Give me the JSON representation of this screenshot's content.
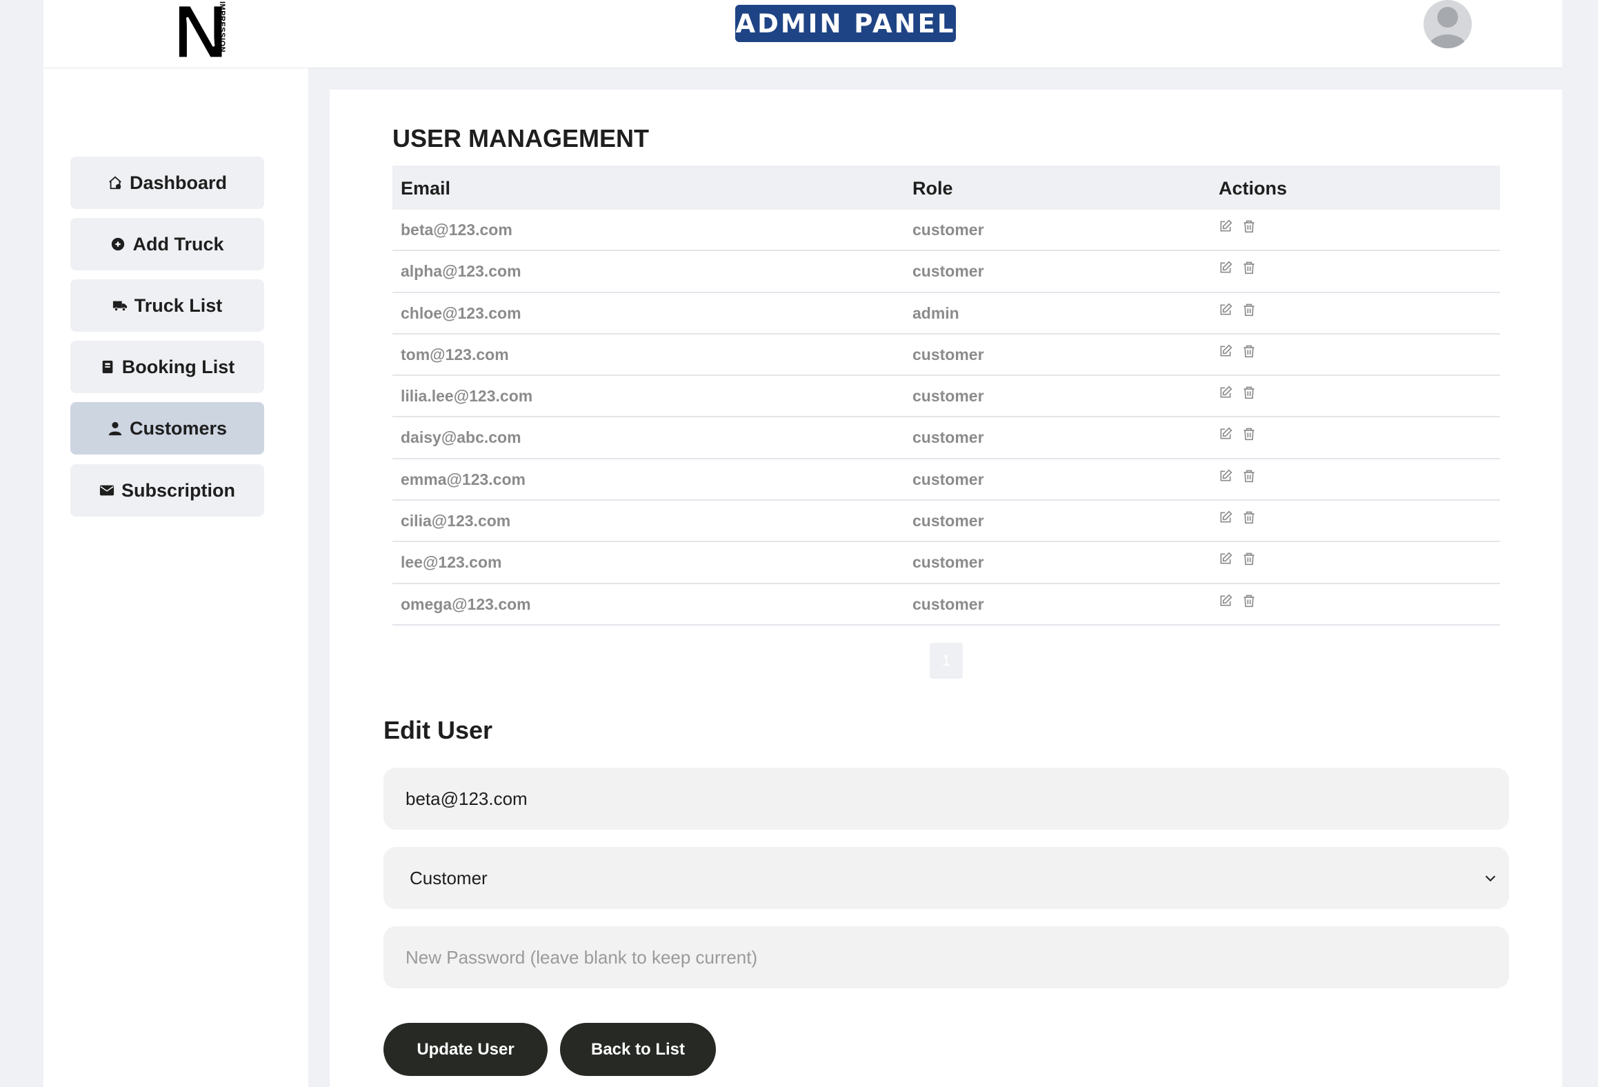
{
  "header": {
    "title": "ADMIN PANEL",
    "logo_letter": "N",
    "logo_text": "IMPRESSION"
  },
  "sidebar": {
    "items": [
      {
        "label": "Dashboard",
        "icon": "home-icon"
      },
      {
        "label": "Add Truck",
        "icon": "add-circle-icon"
      },
      {
        "label": "Truck List",
        "icon": "truck-icon"
      },
      {
        "label": "Booking List",
        "icon": "book-icon"
      },
      {
        "label": "Customers",
        "icon": "user-icon",
        "active": true
      },
      {
        "label": "Subscription",
        "icon": "envelope-icon"
      }
    ]
  },
  "main": {
    "title": "USER MANAGEMENT",
    "columns": [
      "Email",
      "Role",
      "Actions"
    ],
    "rows": [
      {
        "email": "beta@123.com",
        "role": "customer"
      },
      {
        "email": "alpha@123.com",
        "role": "customer"
      },
      {
        "email": "chloe@123.com",
        "role": "admin"
      },
      {
        "email": "tom@123.com",
        "role": "customer"
      },
      {
        "email": "lilia.lee@123.com",
        "role": "customer"
      },
      {
        "email": "daisy@abc.com",
        "role": "customer"
      },
      {
        "email": "emma@123.com",
        "role": "customer"
      },
      {
        "email": "cilia@123.com",
        "role": "customer"
      },
      {
        "email": "lee@123.com",
        "role": "customer"
      },
      {
        "email": "omega@123.com",
        "role": "customer"
      }
    ],
    "pagination": {
      "current_page": "1"
    }
  },
  "edit": {
    "title": "Edit User",
    "email_value": "beta@123.com",
    "role_value": "Customer",
    "password_placeholder": "New Password (leave blank to keep current)",
    "update_label": "Update User",
    "back_label": "Back to List"
  },
  "colors": {
    "badge": "#1f4485",
    "active_nav": "#cdd5e1",
    "button": "#262924"
  }
}
